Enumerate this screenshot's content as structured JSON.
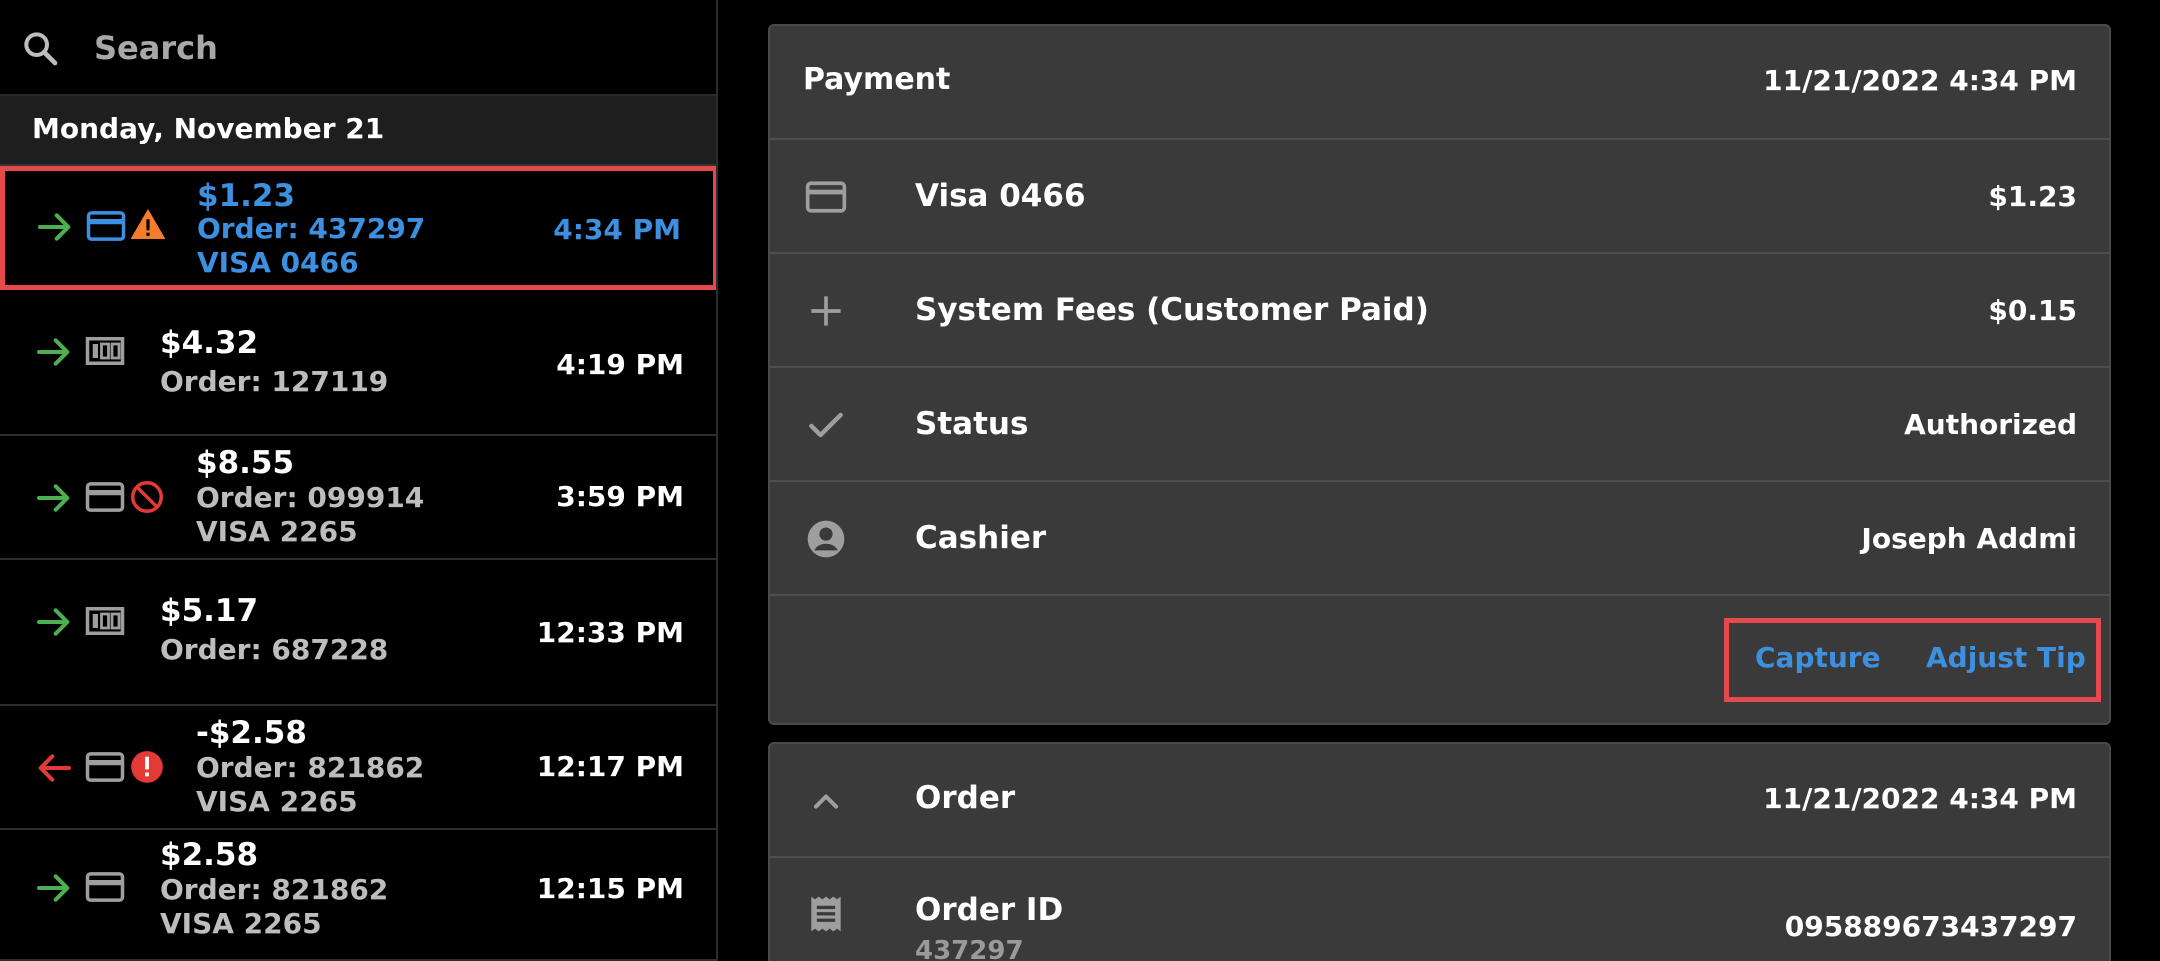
{
  "search": {
    "placeholder": "Search"
  },
  "date_header": "Monday, November 21",
  "transactions": [
    {
      "amount": "$1.23",
      "order": "Order: 437297",
      "card": "VISA 0466",
      "time": "4:34 PM",
      "direction": "in",
      "method": "card-icon",
      "flag": "warning-icon",
      "selected": true
    },
    {
      "amount": "$4.32",
      "order": "Order: 127119",
      "card": "",
      "time": "4:19 PM",
      "direction": "in",
      "method": "cash-icon",
      "flag": "",
      "selected": false
    },
    {
      "amount": "$8.55",
      "order": "Order: 099914",
      "card": "VISA 2265",
      "time": "3:59 PM",
      "direction": "in",
      "method": "card-icon",
      "flag": "blocked-icon",
      "selected": false
    },
    {
      "amount": "$5.17",
      "order": "Order: 687228",
      "card": "",
      "time": "12:33 PM",
      "direction": "in",
      "method": "cash-icon",
      "flag": "",
      "selected": false
    },
    {
      "amount": "-$2.58",
      "order": "Order: 821862",
      "card": "VISA 2265",
      "time": "12:17 PM",
      "direction": "out",
      "method": "card-icon",
      "flag": "error-icon",
      "selected": false
    },
    {
      "amount": "$2.58",
      "order": "Order: 821862",
      "card": "VISA 2265",
      "time": "12:15 PM",
      "direction": "in",
      "method": "card-icon",
      "flag": "",
      "selected": false
    }
  ],
  "payment": {
    "title": "Payment",
    "datetime": "11/21/2022 4:34 PM",
    "rows": [
      {
        "icon": "credit-card-icon",
        "label": "Visa 0466",
        "value": "$1.23"
      },
      {
        "icon": "plus-icon",
        "label": "System Fees (Customer Paid)",
        "value": "$0.15"
      },
      {
        "icon": "check-icon",
        "label": "Status",
        "value": "Authorized"
      },
      {
        "icon": "account-circle-icon",
        "label": "Cashier",
        "value": "Joseph Addmi"
      }
    ],
    "actions": {
      "capture": "Capture",
      "adjust_tip": "Adjust Tip"
    }
  },
  "order": {
    "title": "Order",
    "datetime": "11/21/2022 4:34 PM",
    "order_id_label": "Order ID",
    "order_id_sub": "437297",
    "order_id_value": "095889673437297"
  },
  "colors": {
    "accent_blue": "#3d8fe0",
    "incoming_green": "#4caf50",
    "outgoing_red": "#e53935",
    "warning_orange": "#f57c2b",
    "highlight_red": "#e5484d",
    "panel_bg": "#3a3a3a"
  }
}
